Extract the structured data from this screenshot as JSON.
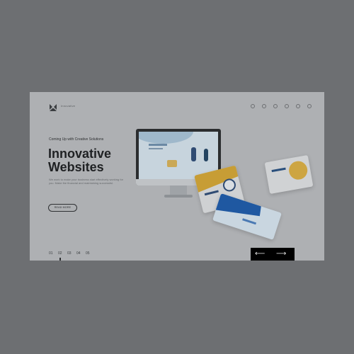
{
  "header": {
    "brand": "Innovative",
    "social_icons": [
      "facebook-icon",
      "twitter-icon",
      "pinterest-icon",
      "youtube-icon",
      "instagram-icon",
      "linkedin-icon"
    ]
  },
  "hero": {
    "kicker": "Coming Up with Creative Solutions",
    "title_line1": "Innovative",
    "title_line2": "Websites",
    "description": "We work to make your business start effectively working for you. Make the financial and maintaining successful.",
    "button_label": "READ MORE"
  },
  "pagination": {
    "items": [
      "01",
      "02",
      "03",
      "04",
      "05"
    ],
    "active": "02"
  },
  "colors": {
    "overlay": "#6d6f72",
    "card": "#aeb0b3",
    "nav_bg": "#000000",
    "accent_blue": "#1f58a1",
    "accent_yellow": "#c79d35"
  }
}
